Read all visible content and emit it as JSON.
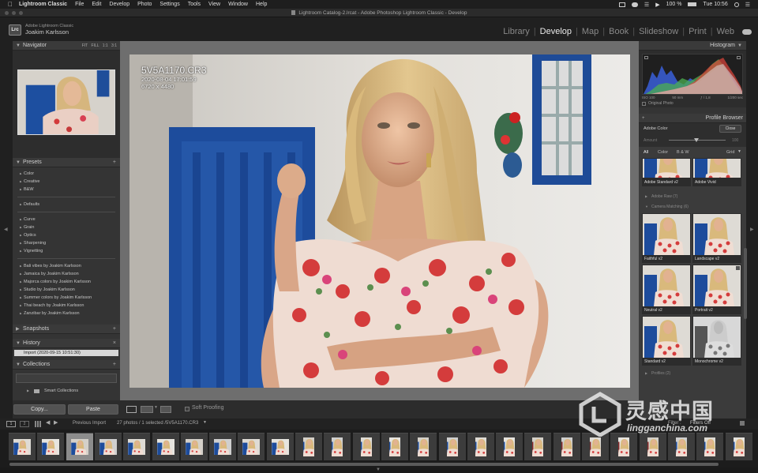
{
  "menubar": {
    "apple": "",
    "items": [
      "Lightroom Classic",
      "File",
      "Edit",
      "Develop",
      "Photo",
      "Settings",
      "Tools",
      "View",
      "Window",
      "Help"
    ],
    "battery": "100 %",
    "clock": "Tue 10:56"
  },
  "window": {
    "title": "Lightroom Catalog-2.lrcat - Adobe Photoshop Lightroom Classic - Develop"
  },
  "identity": {
    "logo": "Lrc",
    "line1": "Adobe Lightroom Classic",
    "line2": "Joakim Karlsson"
  },
  "modules": [
    {
      "label": "Library",
      "active": false
    },
    {
      "label": "Develop",
      "active": true
    },
    {
      "label": "Map",
      "active": false
    },
    {
      "label": "Book",
      "active": false
    },
    {
      "label": "Slideshow",
      "active": false
    },
    {
      "label": "Print",
      "active": false
    },
    {
      "label": "Web",
      "active": false
    }
  ],
  "left": {
    "navigator": {
      "title": "Navigator",
      "zooms": "FIT FILL 1:1 3:1"
    },
    "presets": {
      "title": "Presets",
      "groups1": [
        "Color",
        "Creative",
        "B&W"
      ],
      "groups2": [
        "Defaults"
      ],
      "groups3": [
        "Curve",
        "Grain",
        "Optics",
        "Sharpening",
        "Vignetting"
      ],
      "groups4": [
        "Bali vibes by Joakim Karlsson",
        "Jamaica by Joakim Karlsson",
        "Majorca colors by Joakim Karlsson",
        "Studio by Joakim Karlsson",
        "Summer colors by Joakim Karlsson",
        "Thai beach by Joakim Karlsson",
        "Zanzibar by Joakim Karlsson"
      ]
    },
    "snapshots": {
      "title": "Snapshots"
    },
    "history": {
      "title": "History",
      "item": "Import (2020-09-15 10:51:30)"
    },
    "collections": {
      "title": "Collections",
      "item": "Smart Collections"
    },
    "copy_label": "Copy...",
    "paste_label": "Paste"
  },
  "photo": {
    "filename": "5V5A1170.CR3",
    "date": "2020-08-04 17:01:59",
    "dimensions": "6720 x 4480"
  },
  "toolbar": {
    "soft_proofing": "Soft Proofing"
  },
  "right": {
    "histogram": {
      "title": "Histogram",
      "iso": "ISO 100",
      "focal": "50 mm",
      "aperture": "ƒ / 1,8",
      "shutter": "1/200 sec",
      "original_photo": "Original Photo"
    },
    "profile_browser": {
      "title": "Profile Browser",
      "current": "Adobe Color",
      "close": "Close",
      "amount": "Amount",
      "amount_value": "100",
      "filters": [
        "All",
        "Color",
        "B & W"
      ],
      "view": "Grid",
      "top_labels": [
        "Adobe Standard v2",
        "Adobe Vivid"
      ],
      "groups": {
        "adobe_raw": "Adobe Raw (7)",
        "camera_matching": "Camera Matching (6)",
        "profiles": "Profiles (2)"
      },
      "camera_profiles": [
        "Faithful v2",
        "Landscape v2",
        "Neutral v2",
        "Portrait v2",
        "Standard v2",
        "Monochrome v2"
      ]
    }
  },
  "filmstrip": {
    "source": "Previous Import",
    "count": "27 photos / 1 selected /5V5A1170.CR3",
    "filter_label": "Filter :",
    "filters_off": "Filters Off",
    "pages": [
      "1",
      "2"
    ]
  },
  "watermark": {
    "brand": "灵感中国",
    "url": "lingganchina.com"
  }
}
